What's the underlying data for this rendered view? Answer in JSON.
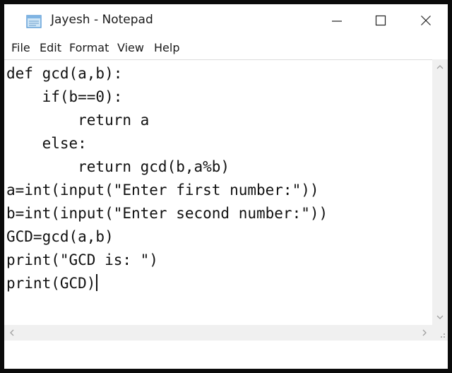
{
  "window": {
    "title": "Jayesh - Notepad",
    "icons": {
      "app": "notepad-icon",
      "minimize": "minimize-icon",
      "maximize": "maximize-icon",
      "close": "close-icon"
    }
  },
  "menu": {
    "items": [
      "File",
      "Edit",
      "Format",
      "View",
      "Help"
    ]
  },
  "editor": {
    "lines": [
      "def gcd(a,b):",
      "    if(b==0):",
      "        return a",
      "    else:",
      "        return gcd(b,a%b)",
      "a=int(input(\"Enter first number:\"))",
      "b=int(input(\"Enter second number:\"))",
      "GCD=gcd(a,b)",
      "print(\"GCD is: \")",
      "print(GCD)"
    ]
  },
  "scrollbars": {
    "icons": [
      "chevron-up-icon",
      "chevron-down-icon",
      "chevron-left-icon",
      "chevron-right-icon",
      "resize-grip-icon"
    ]
  },
  "colors": {
    "frame": "#0b0b0b",
    "text": "#111111",
    "scroll_track": "#f0f0f0",
    "scroll_arrow": "#a0a0a0"
  }
}
